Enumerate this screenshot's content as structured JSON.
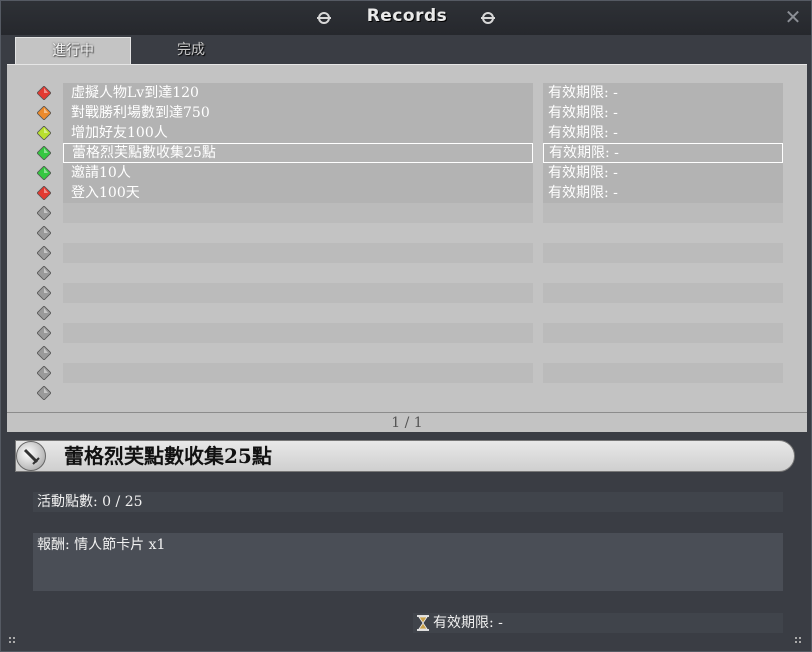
{
  "window": {
    "title": "Records",
    "close_label": "✕"
  },
  "tabs": [
    {
      "label": "進行中",
      "active": true
    },
    {
      "label": "完成",
      "active": false
    }
  ],
  "rows": [
    {
      "gem": "#e23a32",
      "name": "虛擬人物Lv到達120",
      "expiry": "有效期限: -"
    },
    {
      "gem": "#ec8a2c",
      "name": "對戰勝利場數到達750",
      "expiry": "有效期限: -"
    },
    {
      "gem": "#b8e02e",
      "name": "增加好友100人",
      "expiry": "有效期限: -"
    },
    {
      "gem": "#35c741",
      "name": "蕾格烈芙點數收集25點",
      "expiry": "有效期限: -",
      "selected": true
    },
    {
      "gem": "#35c741",
      "name": "邀請10人",
      "expiry": "有效期限: -"
    },
    {
      "gem": "#e23a32",
      "name": "登入100天",
      "expiry": "有效期限: -"
    }
  ],
  "empty_rows": 10,
  "pager": {
    "text": "1 / 1"
  },
  "detail": {
    "title": "蕾格烈芙點數收集25點",
    "points": "活動點數: 0 / 25",
    "reward": "報酬: 情人節卡片 x1",
    "expiry": "有效期限: -"
  },
  "colors": {
    "empty_gem": "#9a9a9a"
  }
}
